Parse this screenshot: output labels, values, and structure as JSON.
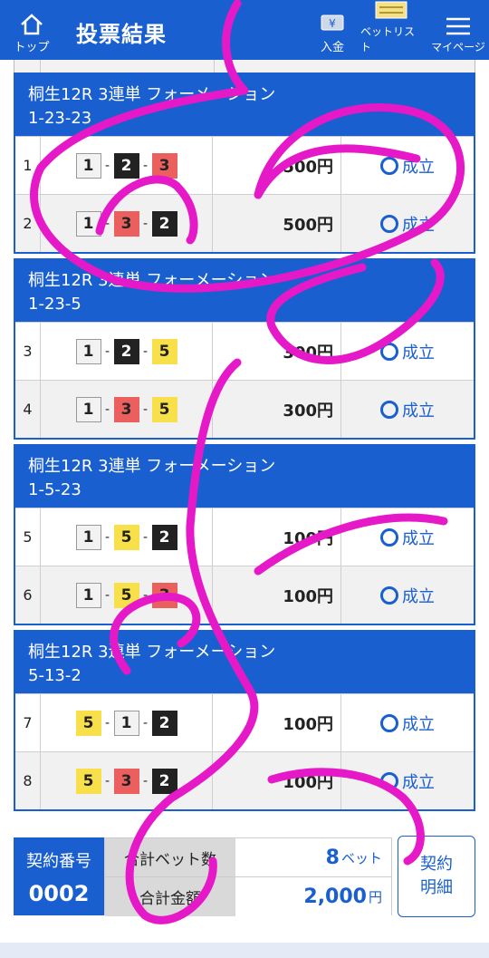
{
  "header": {
    "title": "投票結果",
    "home_label": "トップ",
    "deposit_label": "入金",
    "betlist_label": "ベットリスト",
    "mypage_label": "マイページ"
  },
  "groups": [
    {
      "title": "桐生12R 3連単 フォーメーション",
      "pattern": "1-23-23",
      "rows": [
        {
          "no": "1",
          "combo": [
            1,
            2,
            3
          ],
          "amount": "500円",
          "status": "成立"
        },
        {
          "no": "2",
          "combo": [
            1,
            3,
            2
          ],
          "amount": "500円",
          "status": "成立"
        }
      ]
    },
    {
      "title": "桐生12R 3連単 フォーメーション",
      "pattern": "1-23-5",
      "rows": [
        {
          "no": "3",
          "combo": [
            1,
            2,
            5
          ],
          "amount": "300円",
          "status": "成立"
        },
        {
          "no": "4",
          "combo": [
            1,
            3,
            5
          ],
          "amount": "300円",
          "status": "成立"
        }
      ]
    },
    {
      "title": "桐生12R 3連単 フォーメーション",
      "pattern": "1-5-23",
      "rows": [
        {
          "no": "5",
          "combo": [
            1,
            5,
            2
          ],
          "amount": "100円",
          "status": "成立"
        },
        {
          "no": "6",
          "combo": [
            1,
            5,
            3
          ],
          "amount": "100円",
          "status": "成立"
        }
      ]
    },
    {
      "title": "桐生12R 3連単 フォーメーション",
      "pattern": "5-13-2",
      "rows": [
        {
          "no": "7",
          "combo": [
            5,
            1,
            2
          ],
          "amount": "100円",
          "status": "成立"
        },
        {
          "no": "8",
          "combo": [
            5,
            3,
            2
          ],
          "amount": "100円",
          "status": "成立"
        }
      ]
    }
  ],
  "summary": {
    "contract_label": "契約番号",
    "contract_no": "0002",
    "total_bets_label": "合計ベット数",
    "total_bets": "8",
    "total_bets_unit": "ベット",
    "total_amount_label": "合計金額",
    "total_amount": "2,000",
    "total_amount_unit": "円",
    "detail_button_line1": "契約",
    "detail_button_line2": "明細"
  },
  "colors": {
    "accent": "#1a5fcf",
    "boat1": "#f2f2f2",
    "boat2": "#222222",
    "boat3": "#ec5f5f",
    "boat5": "#f8e04a",
    "scribble": "#e619c8"
  },
  "icons": [
    "home-icon",
    "deposit-yen-icon",
    "betlist-ticket-icon",
    "menu-icon",
    "status-circle-icon"
  ]
}
